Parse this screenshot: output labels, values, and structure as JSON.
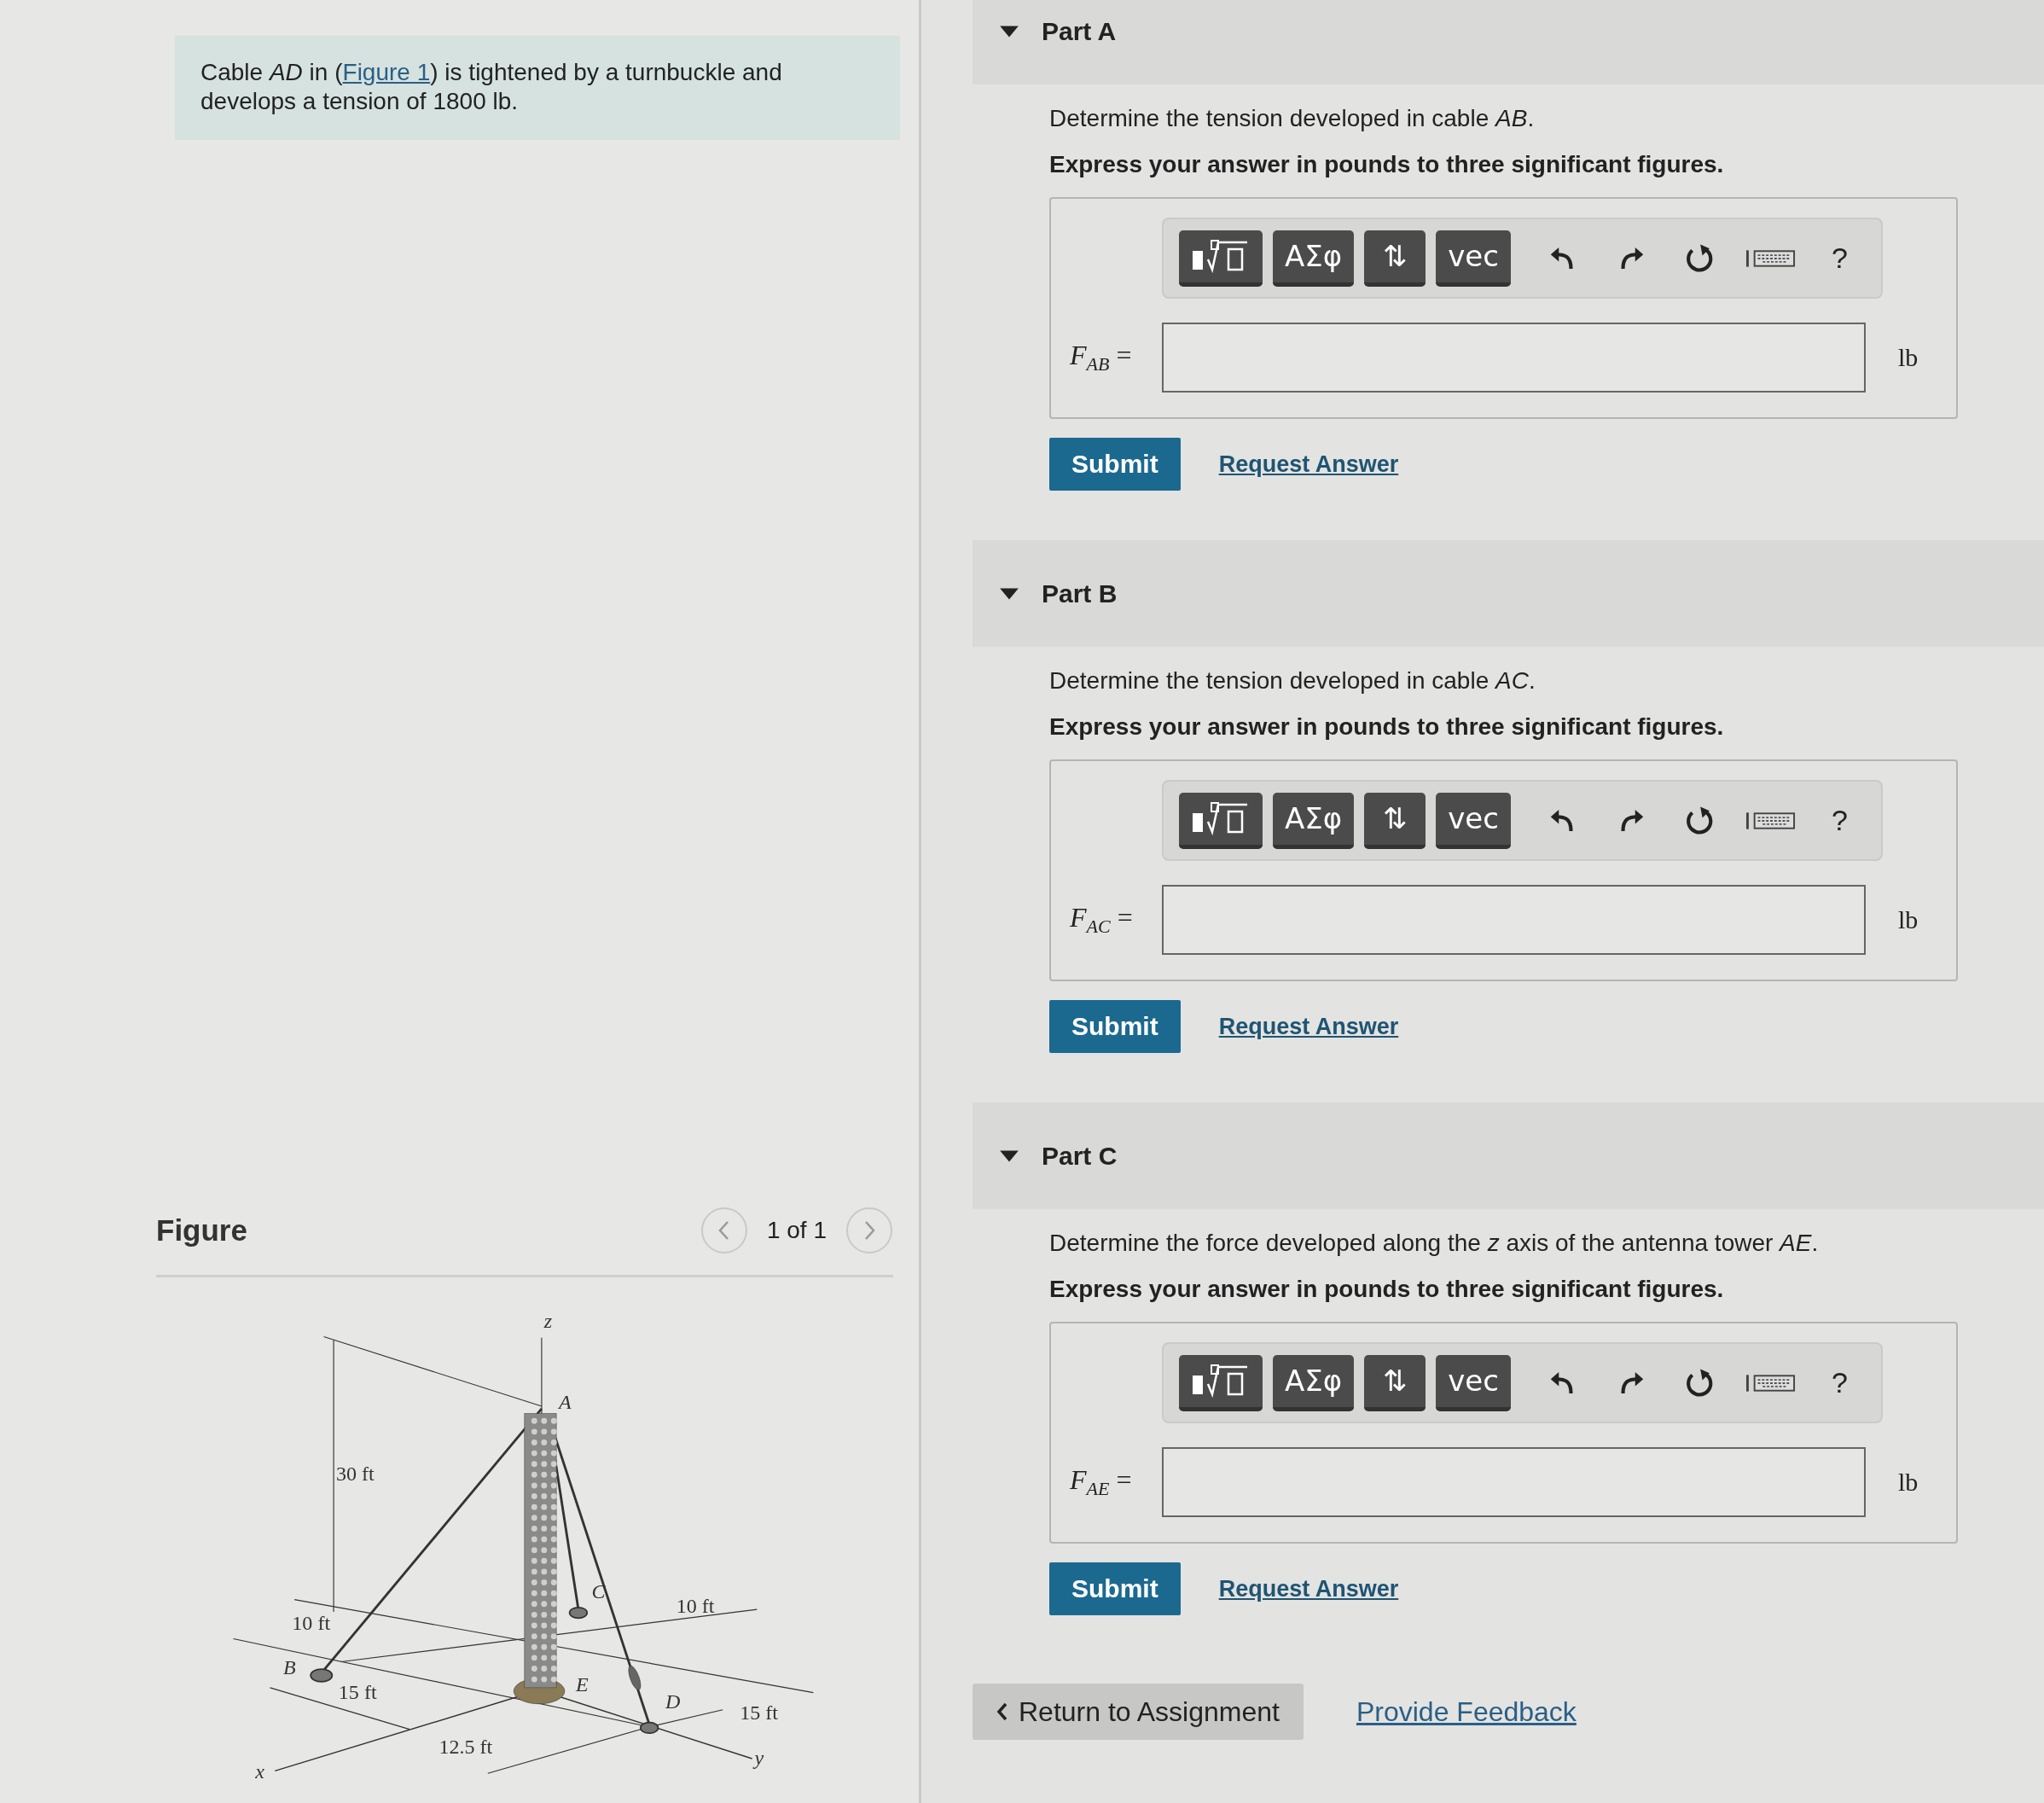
{
  "intro": {
    "before": "Cable *AD* in (",
    "link": "Figure 1",
    "after": ") is tightened by a turnbuckle and develops a tension of 1800 lb."
  },
  "figure": {
    "title": "Figure",
    "pager": "1 of 1",
    "labels": [
      "z",
      "A",
      "30 ft",
      "10 ft",
      "B",
      "15 ft",
      "12.5 ft",
      "x",
      "C",
      "10 ft",
      "E",
      "D",
      "15 ft",
      "y"
    ]
  },
  "parts": [
    {
      "title": "Part A",
      "expanded": true,
      "question": "Determine the tension developed in cable *AB*.",
      "instruction": "Express your answer in pounds to three significant figures.",
      "buttons": [
        "ΑΣφ",
        "⇅",
        "vec"
      ],
      "help": "?",
      "symbol": "F",
      "subscript": "AB",
      "equals": "=",
      "unit": "lb",
      "submit": "Submit",
      "request": "Request Answer"
    },
    {
      "title": "Part B",
      "expanded": true,
      "question": "Determine the tension developed in cable *AC*.",
      "instruction": "Express your answer in pounds to three significant figures.",
      "buttons": [
        "ΑΣφ",
        "⇅",
        "vec"
      ],
      "help": "?",
      "symbol": "F",
      "subscript": "AC",
      "equals": "=",
      "unit": "lb",
      "submit": "Submit",
      "request": "Request Answer"
    },
    {
      "title": "Part C",
      "expanded": true,
      "question": "Determine the force developed along the *z* axis of the antenna tower *AE*.",
      "instruction": "Express your answer in pounds to three significant figures.",
      "buttons": [
        "ΑΣφ",
        "⇅",
        "vec"
      ],
      "help": "?",
      "symbol": "F",
      "subscript": "AE",
      "equals": "=",
      "unit": "lb",
      "submit": "Submit",
      "request": "Request Answer"
    }
  ],
  "footer": {
    "back": "Return to Assignment",
    "feedback": "Provide Feedback"
  }
}
